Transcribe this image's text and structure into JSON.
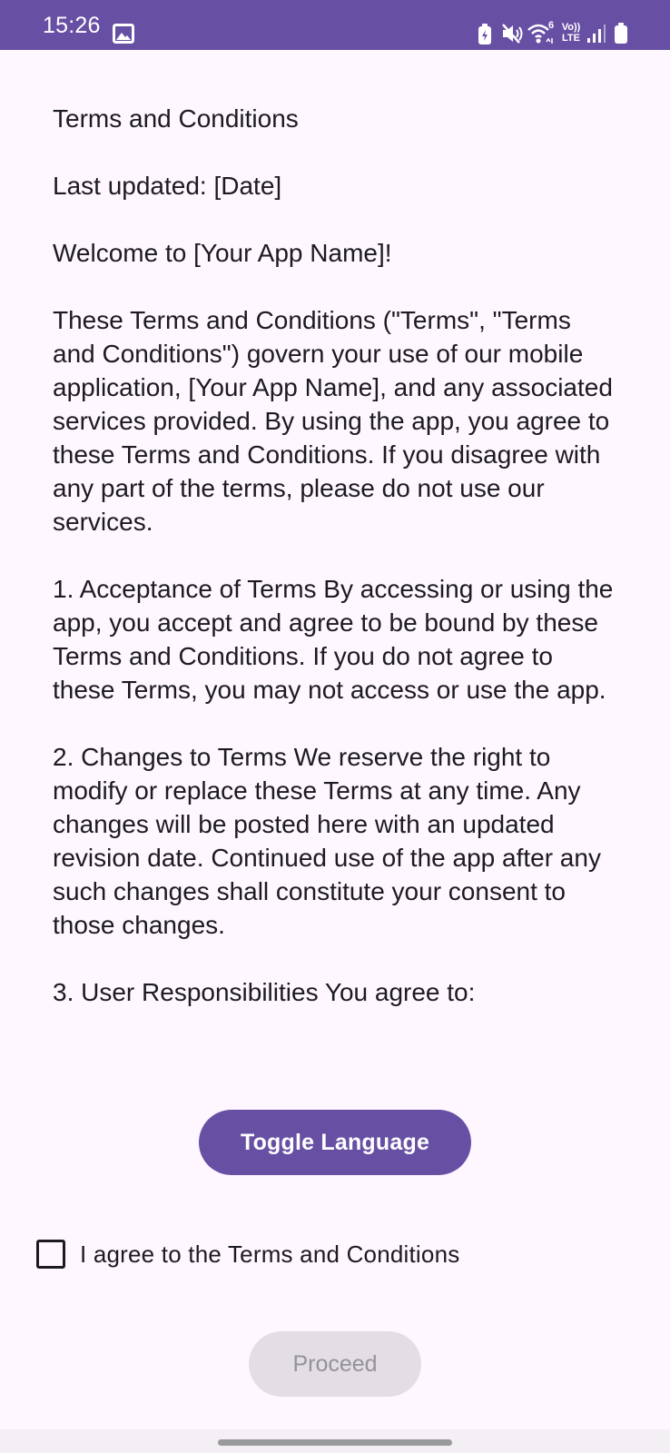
{
  "status_bar": {
    "time": "15:26",
    "icons": [
      "gallery-icon",
      "battery-saver-icon",
      "mute-icon",
      "wifi-6-icon",
      "volte-icon",
      "signal-icon",
      "battery-icon"
    ],
    "wifi_badge": "6",
    "volte_top": "Vo))",
    "volte_bottom": "LTE",
    "background": "#6750A4"
  },
  "terms": {
    "title": "Terms and Conditions",
    "last_updated": "Last updated: [Date]",
    "welcome": "Welcome to [Your App Name]!",
    "intro": "These Terms and Conditions (\"Terms\", \"Terms and Conditions\") govern your use of our mobile application, [Your App Name], and any associated services provided. By using the app, you agree to these Terms and Conditions. If you disagree with any part of the terms, please do not use our services.",
    "section1": "1. Acceptance of Terms By accessing or using the app, you accept and agree to be bound by these Terms and Conditions. If you do not agree to these Terms, you may not access or use the app.",
    "section2": "2. Changes to Terms We reserve the right to modify or replace these Terms at any time. Any changes will be posted here with an updated revision date. Continued use of the app after any such changes shall constitute your consent to those changes.",
    "section3": "3. User Responsibilities You agree to:"
  },
  "actions": {
    "toggle_language_label": "Toggle Language",
    "agree_label": "I agree to the Terms and Conditions",
    "agree_checked": false,
    "proceed_label": "Proceed",
    "proceed_enabled": false
  },
  "colors": {
    "accent": "#6750A4",
    "background": "#FEF7FF",
    "disabled_bg": "#E3DEE5",
    "disabled_text": "#959297"
  }
}
